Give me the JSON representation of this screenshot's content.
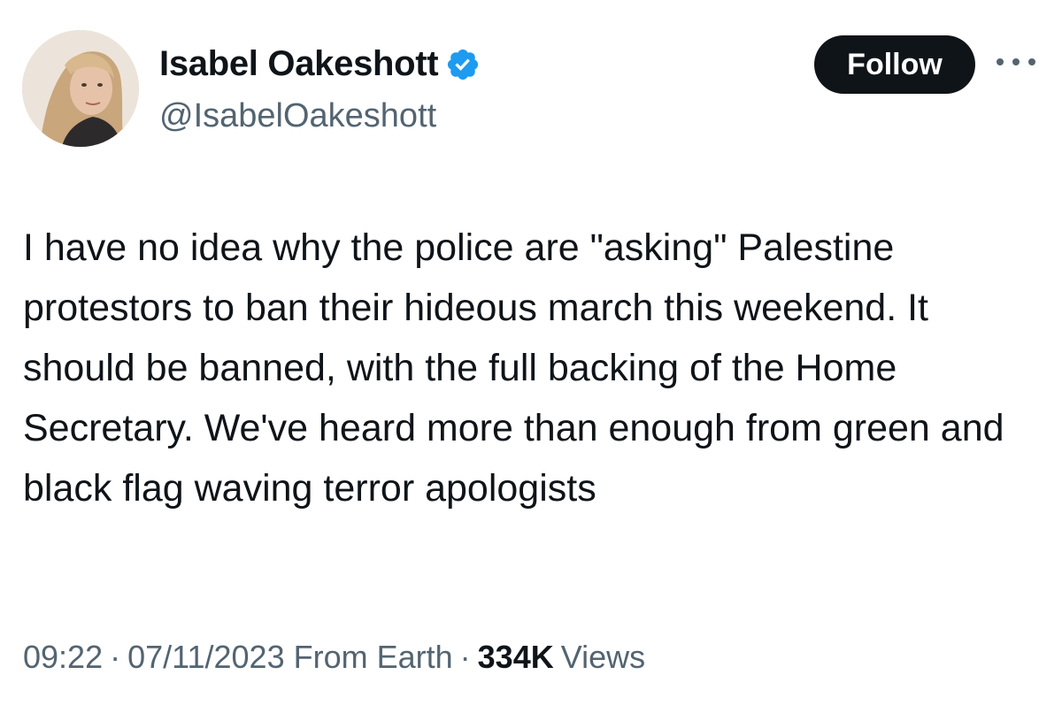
{
  "author": {
    "display_name": "Isabel Oakeshott",
    "handle": "@IsabelOakeshott",
    "verified": true,
    "avatar_icon": "profile-photo"
  },
  "actions": {
    "follow_label": "Follow",
    "more_icon": "more-horizontal-icon"
  },
  "tweet": {
    "text": "I have no idea why the police are \"asking\" Palestine protestors to ban their hideous march this weekend. It should be banned, with the full backing of the Home Secretary. We've heard more than enough from green and black flag waving terror apologists"
  },
  "meta": {
    "time": "09:22",
    "separator": "·",
    "date": "07/11/2023",
    "location": "From Earth",
    "views_count": "334K",
    "views_label": "Views"
  },
  "colors": {
    "text_primary": "#0f1419",
    "text_secondary": "#536471",
    "verified_blue": "#1d9bf0",
    "button_bg": "#0f1419"
  }
}
